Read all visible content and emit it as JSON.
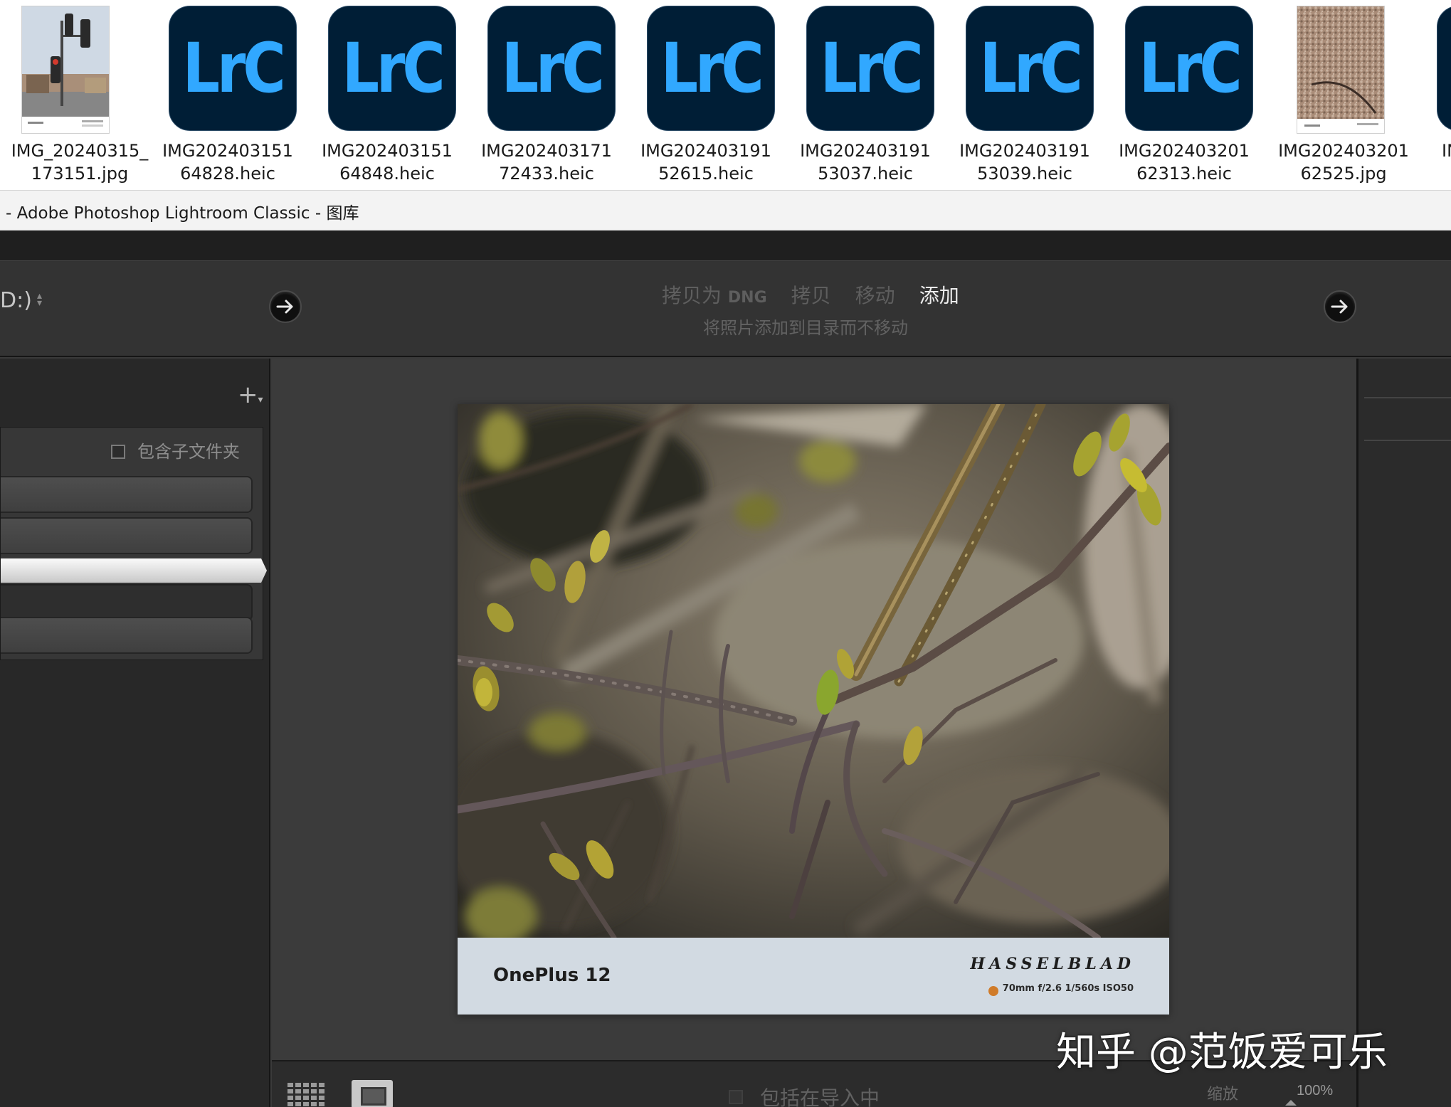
{
  "explorer": {
    "files": [
      {
        "name_line1": "IMG_20240315_",
        "name_line2": "173151.jpg",
        "kind": "traffic-light-photo-thumbnail"
      },
      {
        "name_line1": "IMG202403151",
        "name_line2": "64828.heic",
        "kind": "lrc-icon"
      },
      {
        "name_line1": "IMG202403151",
        "name_line2": "64848.heic",
        "kind": "lrc-icon"
      },
      {
        "name_line1": "IMG202403171",
        "name_line2": "72433.heic",
        "kind": "lrc-icon"
      },
      {
        "name_line1": "IMG202403191",
        "name_line2": "52615.heic",
        "kind": "lrc-icon"
      },
      {
        "name_line1": "IMG202403191",
        "name_line2": "53037.heic",
        "kind": "lrc-icon"
      },
      {
        "name_line1": "IMG202403191",
        "name_line2": "53039.heic",
        "kind": "lrc-icon"
      },
      {
        "name_line1": "IMG202403201",
        "name_line2": "62313.heic",
        "kind": "lrc-icon"
      },
      {
        "name_line1": "IMG202403201",
        "name_line2": "62525.jpg",
        "kind": "gravel-photo-thumbnail"
      },
      {
        "name_line1": "IN",
        "name_line2": "",
        "kind": "lrc-icon"
      }
    ],
    "lrc_label": "LrC"
  },
  "titlebar": {
    "title": "- Adobe Photoshop Lightroom Classic - 图库"
  },
  "importbar": {
    "source_label": "D:)",
    "modes": [
      {
        "main": "拷贝为",
        "suffix": "DNG",
        "active": false
      },
      {
        "main": "拷贝",
        "suffix": "",
        "active": false
      },
      {
        "main": "移动",
        "suffix": "",
        "active": false
      },
      {
        "main": "添加",
        "suffix": "",
        "active": true
      }
    ],
    "mode_description": "将照片添加到目录而不移动"
  },
  "left_panel": {
    "include_subfolders_label": "包含子文件夹",
    "include_subfolders_checked": false
  },
  "photo": {
    "frame_model": "OnePlus 12",
    "frame_brand": "HASSELBLAD",
    "frame_exif": "70mm  f/2.6  1/560s  ISO50"
  },
  "toolbar": {
    "include_in_import_label": "包括在导入中",
    "zoom_label": "缩放",
    "zoom_value": "100%"
  },
  "watermark": {
    "text": "知乎 @范饭爱可乐"
  },
  "colors": {
    "lrc_tile": "#001e36",
    "lrc_text": "#31a8ff",
    "hasselblad_dot": "#d07b29",
    "panel_dark": "#282828"
  }
}
